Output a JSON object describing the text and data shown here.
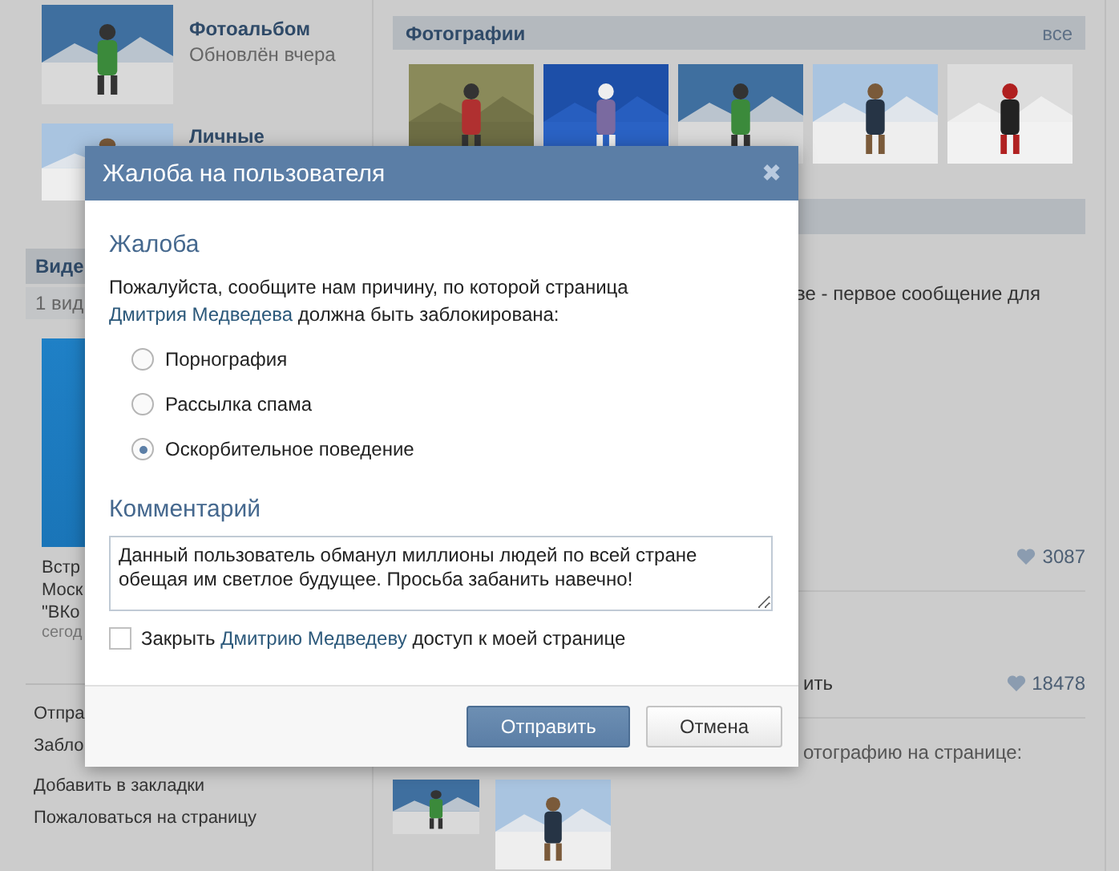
{
  "sidebar": {
    "albums": [
      {
        "title": "Фотоальбом",
        "subtitle": "Обновлён вчера"
      },
      {
        "title": "Личные"
      }
    ],
    "videos": {
      "header": "Виде",
      "count": "1 вид",
      "caption_lines": [
        "Встр",
        "Моск",
        "\"ВКо"
      ],
      "date": "сегод"
    },
    "actions": [
      "Отпра",
      "Забло",
      "Добавить в закладки",
      "Пожаловаться на страницу"
    ]
  },
  "photos_section": {
    "title": "Фотографии",
    "all_link": "все"
  },
  "wall": [
    {
      "text": "ве - первое сообщение для",
      "likes": "3087"
    },
    {
      "text": "ить",
      "likes": "18478"
    },
    {
      "text": "отографию на странице:"
    }
  ],
  "dialog": {
    "title": "Жалоба на пользователя",
    "close": "✖",
    "section_title": "Жалоба",
    "prompt_before": "Пожалуйста, сообщите нам причину, по которой страница",
    "prompt_link": "Дмитрия Медведева",
    "prompt_after": "должна быть заблокирована:",
    "reasons": [
      {
        "label": "Порнография",
        "selected": false
      },
      {
        "label": "Рассылка спама",
        "selected": false
      },
      {
        "label": "Оскорбительное поведение",
        "selected": true
      }
    ],
    "comment_title": "Комментарий",
    "comment": "Данный пользователь обманул миллионы людей по всей стране обещая им светлое будущее. Просьба забанить навечно!",
    "block": {
      "checked": false,
      "before": "Закрыть",
      "link": "Дмитрию Медведеву",
      "after": "доступ к моей странице"
    },
    "buttons": [
      {
        "label": "Отправить",
        "kind": "primary"
      },
      {
        "label": "Отмена",
        "kind": "secondary"
      }
    ]
  }
}
